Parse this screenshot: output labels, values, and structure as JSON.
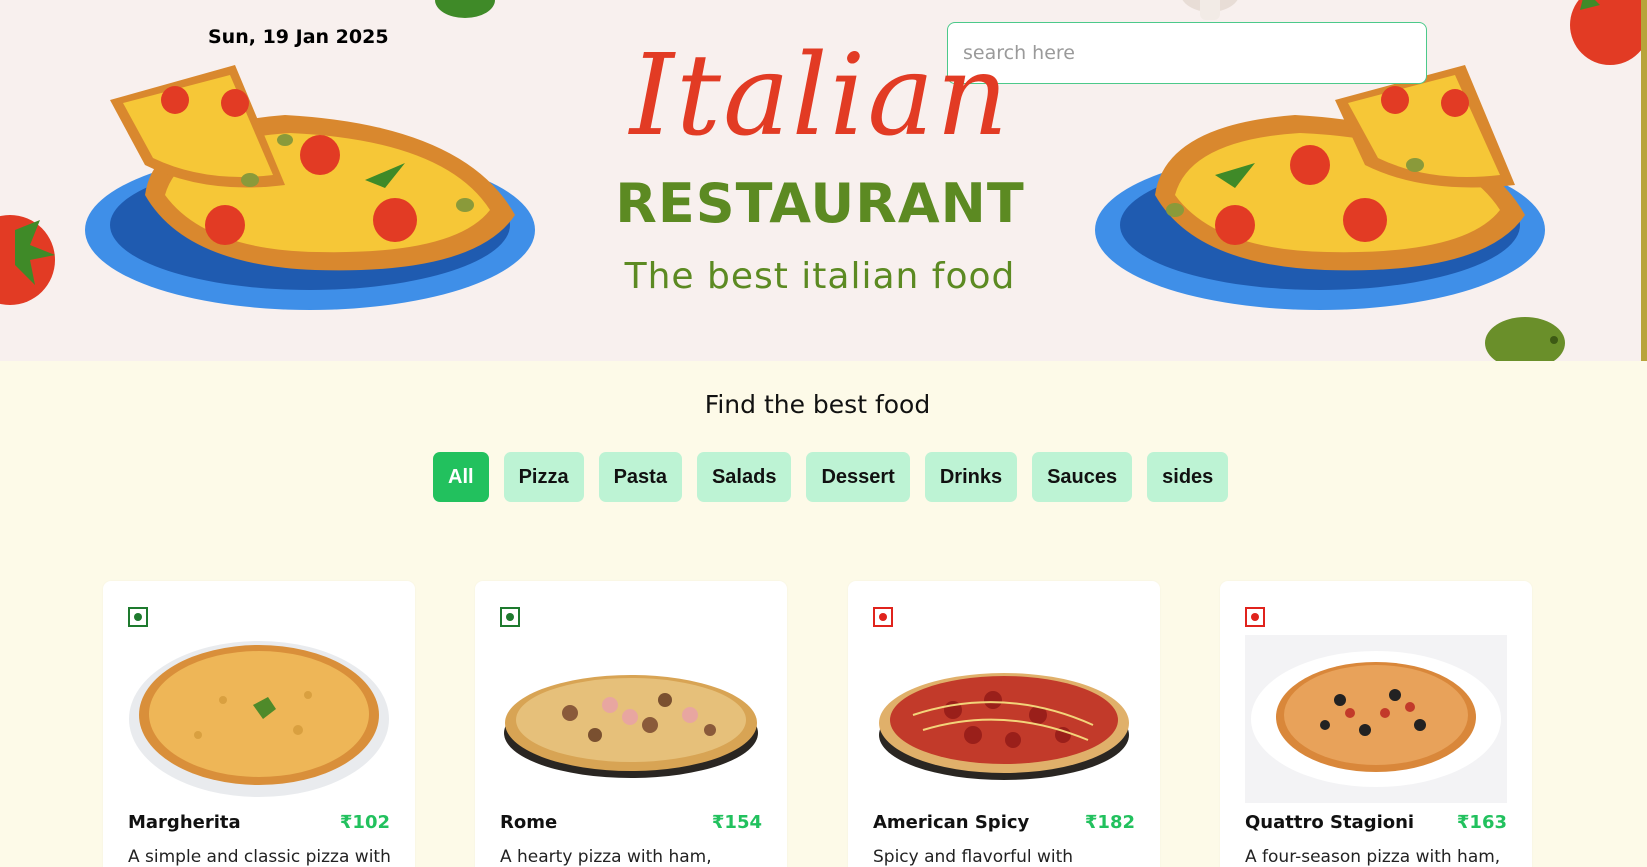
{
  "header": {
    "date": "Sun, 19 Jan 2025",
    "search_placeholder": "search here",
    "brand_script": "Italian",
    "brand_name": "RESTAURANT",
    "tagline": "The best italian food"
  },
  "section": {
    "title": "Find the best food"
  },
  "filters": [
    {
      "label": "All",
      "active": true
    },
    {
      "label": "Pizza",
      "active": false
    },
    {
      "label": "Pasta",
      "active": false
    },
    {
      "label": "Salads",
      "active": false
    },
    {
      "label": "Dessert",
      "active": false
    },
    {
      "label": "Drinks",
      "active": false
    },
    {
      "label": "Sauces",
      "active": false
    },
    {
      "label": "sides",
      "active": false
    }
  ],
  "cards": [
    {
      "name": "Margherita",
      "price": "₹102",
      "desc": "A simple and classic pizza with",
      "veg": true
    },
    {
      "name": "Rome",
      "price": "₹154",
      "desc": "A hearty pizza with ham,",
      "veg": true
    },
    {
      "name": "American Spicy",
      "price": "₹182",
      "desc": "Spicy and flavorful with",
      "veg": false
    },
    {
      "name": "Quattro Stagioni",
      "price": "₹163",
      "desc": "A four-season pizza with ham,",
      "veg": false
    }
  ],
  "colors": {
    "accent": "#22c15e",
    "filter_bg": "#bdf3d4",
    "page_bg": "#fdfae8",
    "brand_red": "#e23b24",
    "brand_green": "#5c8a22",
    "veg": "#1e7a2e",
    "nonveg": "#e0231c"
  }
}
